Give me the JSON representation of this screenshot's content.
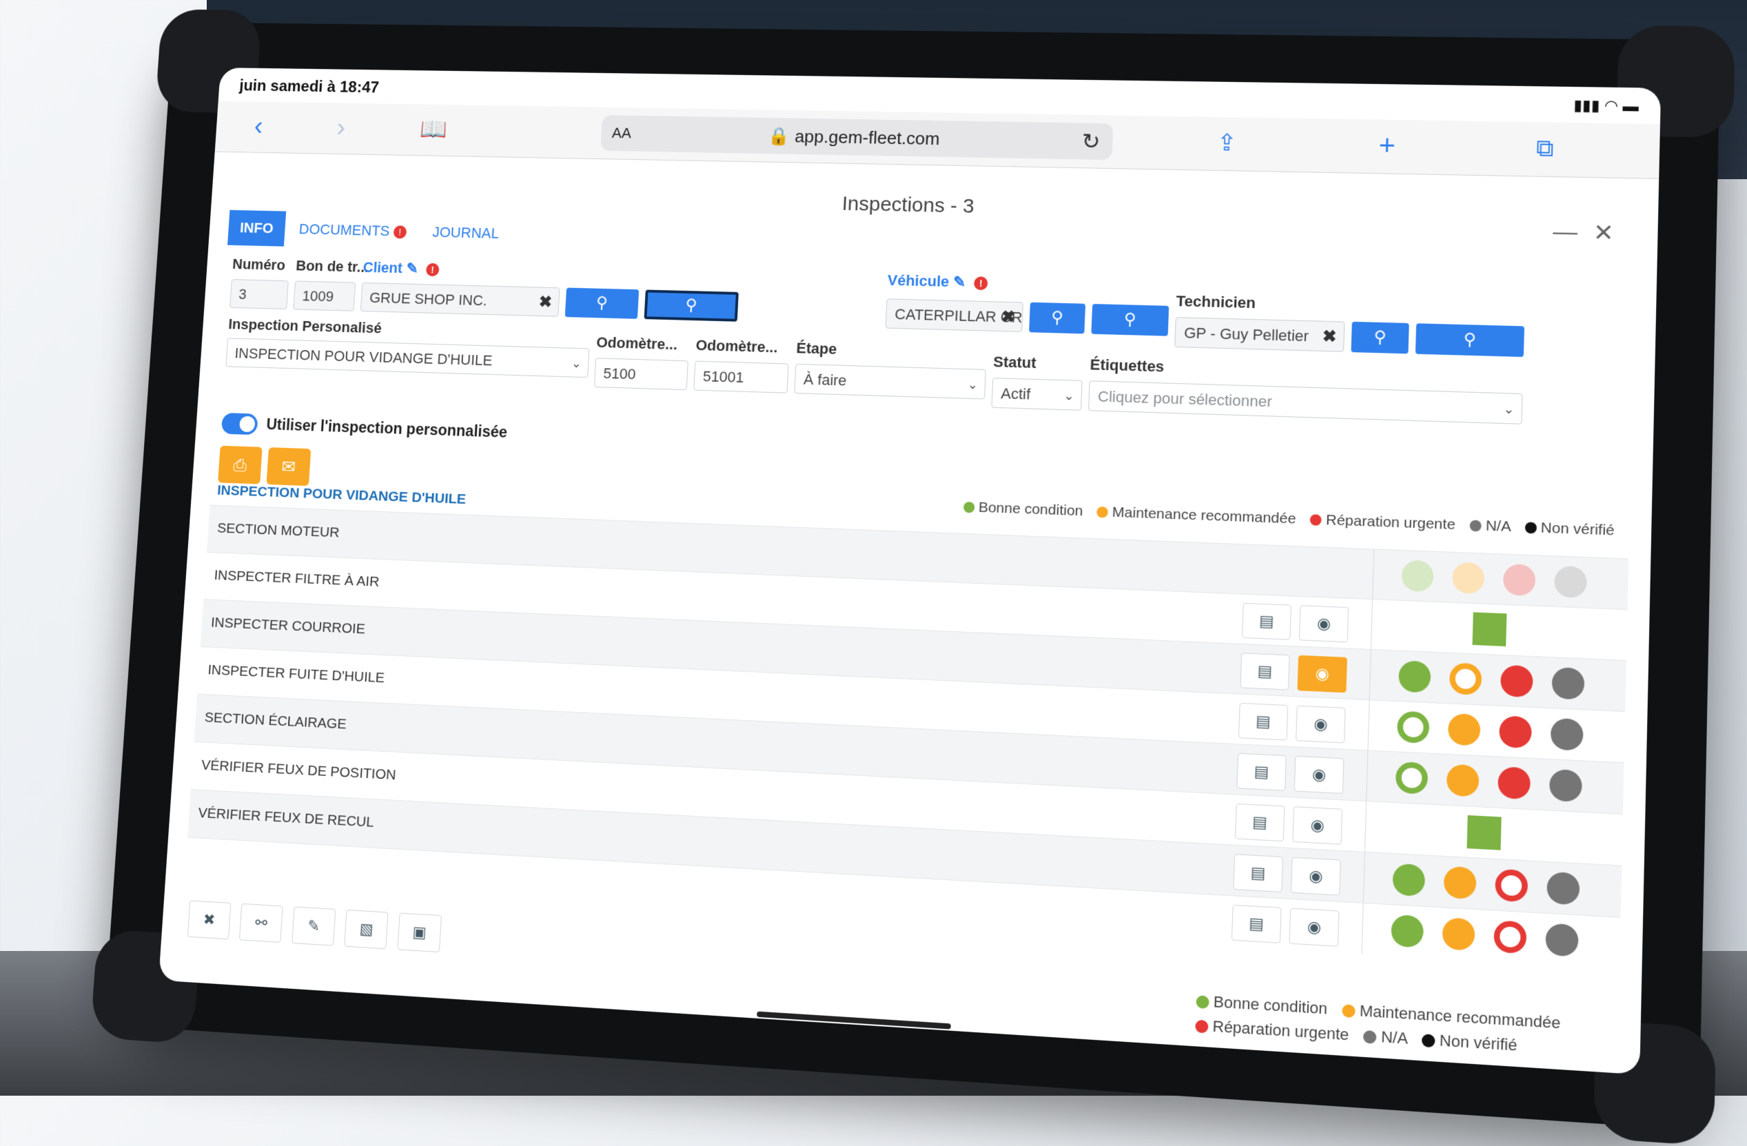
{
  "status": {
    "time": "juin samedi à 18:47"
  },
  "browser": {
    "aa_label": "AA",
    "url": "app.gem-fleet.com",
    "icons": [
      "back-icon",
      "forward-icon",
      "bookmarks-icon",
      "share-icon",
      "new-tab-icon",
      "tabs-icon"
    ]
  },
  "modal": {
    "title": "Inspections - 3",
    "tabs": [
      {
        "label": "INFO",
        "active": true
      },
      {
        "label": "DOCUMENTS",
        "badge": "!"
      },
      {
        "label": "JOURNAL"
      }
    ]
  },
  "form": {
    "numero_label": "Numéro",
    "numero_value": "3",
    "bon_label": "Bon de tr...",
    "bon_value": "1009",
    "client_label": "Client",
    "client_value": "GRUE SHOP INC.",
    "vehicule_label": "Véhicule",
    "vehicule_value": "CATERPILLAR CRO",
    "technicien_label": "Technicien",
    "technicien_value": "GP - Guy Pelletier",
    "insp_label": "Inspection Personalisé",
    "insp_value": "INSPECTION POUR VIDANGE D'HUILE",
    "odo1_label": "Odomètre...",
    "odo1_value": "5100",
    "odo2_label": "Odomètre...",
    "odo2_value": "51001",
    "etape_label": "Étape",
    "etape_value": "À faire",
    "statut_label": "Statut",
    "statut_value": "Actif",
    "etiquettes_label": "Étiquettes",
    "etiquettes_placeholder": "Cliquez pour sélectionner",
    "toggle_label": "Utiliser l'inspection personnalisée"
  },
  "legend": {
    "good": "Bonne condition",
    "maint": "Maintenance recommandée",
    "urgent": "Réparation urgente",
    "na": "N/A",
    "unverified": "Non vérifié"
  },
  "colors": {
    "good": "#7cb342",
    "maint": "#f9a825",
    "urgent": "#e53935",
    "na": "#757575",
    "unverified": "#111111",
    "accent": "#2f80ed"
  },
  "inspection": {
    "title": "INSPECTION POUR VIDANGE D'HUILE",
    "rows": [
      {
        "label": "SECTION MOTEUR",
        "type": "section"
      },
      {
        "label": "INSPECTER FILTRE À AIR",
        "type": "item",
        "state": "good-square"
      },
      {
        "label": "INSPECTER COURROIE",
        "type": "item",
        "state": "maint",
        "photo_alert": true
      },
      {
        "label": "INSPECTER FUITE D'HUILE",
        "type": "item",
        "state": "good"
      },
      {
        "label": "SECTION ÉCLAIRAGE",
        "type": "section",
        "state": "good"
      },
      {
        "label": "VÉRIFIER FEUX DE POSITION",
        "type": "item",
        "state": "good-square"
      },
      {
        "label": "VÉRIFIER FEUX DE RECUL",
        "type": "item",
        "state": "urgent"
      },
      {
        "label": "",
        "type": "item",
        "state": "urgent"
      }
    ]
  }
}
